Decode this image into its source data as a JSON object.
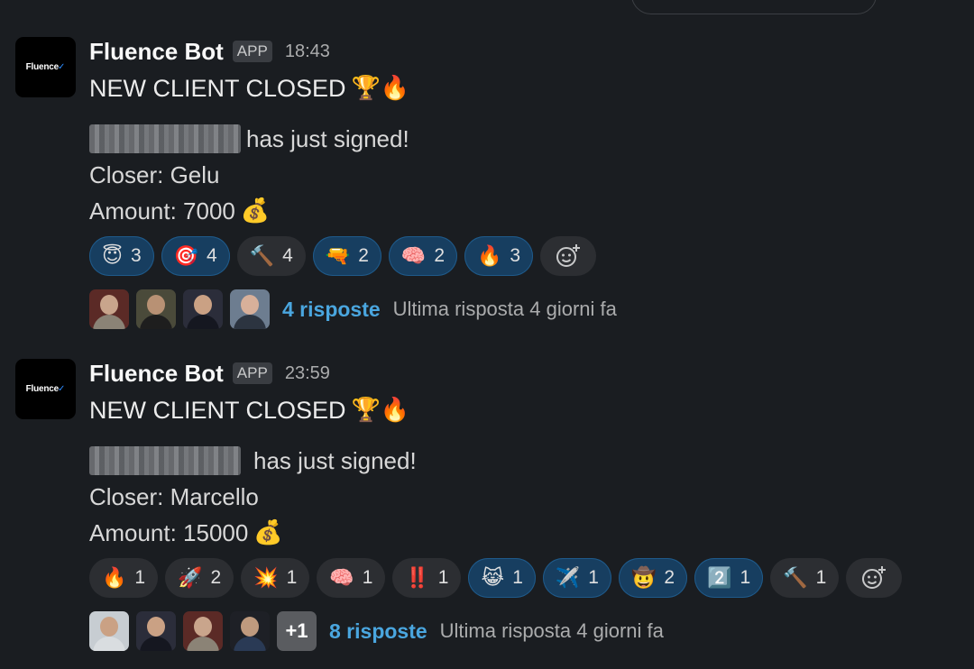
{
  "messages": [
    {
      "sender": "Fluence Bot",
      "badge": "APP",
      "time": "18:43",
      "avatar_text": "Fluence",
      "title": "NEW CLIENT CLOSED",
      "title_emojis": "🏆🔥",
      "signed_text": "has just signed!",
      "closer": "Closer: Gelu",
      "amount": "Amount: 7000",
      "amount_emoji": "💰",
      "reactions": [
        {
          "icon": "😇",
          "count": "3",
          "active": true
        },
        {
          "icon": "🎯",
          "count": "4",
          "active": true
        },
        {
          "icon": "🔨",
          "count": "4",
          "active": true
        },
        {
          "icon": "🔫",
          "count": "2",
          "active": true
        },
        {
          "icon": "🧠",
          "count": "2",
          "active": true
        },
        {
          "icon": "🔥",
          "count": "3",
          "active": true
        }
      ],
      "add_reaction_icon": "add-reaction-icon",
      "reply_count": "4 risposte",
      "reply_last": "Ultima risposta 4 giorni fa"
    },
    {
      "sender": "Fluence Bot",
      "badge": "APP",
      "time": "23:59",
      "avatar_text": "Fluence",
      "title": "NEW CLIENT CLOSED",
      "title_emojis": "🏆🔥",
      "signed_text": "has just signed!",
      "closer": "Closer: Marcello",
      "amount": "Amount: 15000",
      "amount_emoji": "💰",
      "reactions": [
        {
          "icon": "🔥",
          "count": "1",
          "active": false
        },
        {
          "icon": "🚀",
          "count": "2",
          "active": false
        },
        {
          "icon": "💥",
          "count": "1",
          "active": false
        },
        {
          "icon": "🧠",
          "count": "1",
          "active": false
        },
        {
          "icon": "‼️",
          "count": "1",
          "active": false
        },
        {
          "icon": "😹",
          "count": "1",
          "active": true
        },
        {
          "icon": "✈️",
          "count": "1",
          "active": true
        },
        {
          "icon": "🤠",
          "count": "2",
          "active": true
        },
        {
          "icon": "2️⃣",
          "count": "1",
          "active": true
        },
        {
          "icon": "🔨",
          "count": "1",
          "active": false
        }
      ],
      "add_reaction_icon": "add-reaction-icon",
      "extra_participants": "+1",
      "reply_count": "8 risposte",
      "reply_last": "Ultima risposta 4 giorni fa"
    }
  ],
  "colors": {
    "background": "#1a1d21",
    "link": "#4aa6df",
    "active_reaction": "#173e60"
  }
}
